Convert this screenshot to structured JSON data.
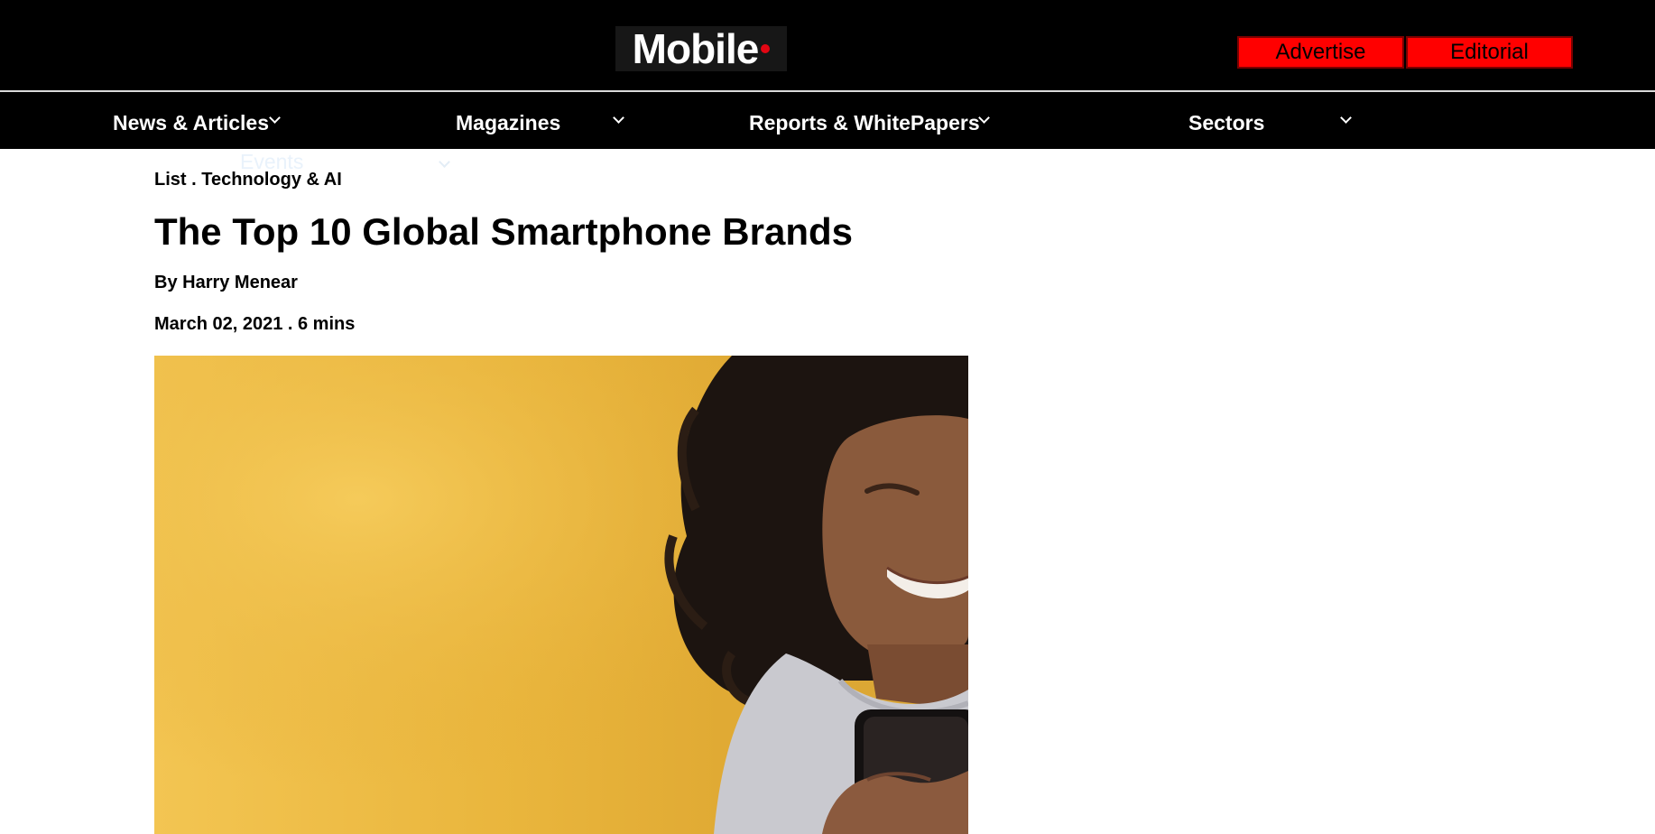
{
  "header": {
    "logo_text": "Mobile",
    "buttons": {
      "advertise": "Advertise",
      "editorial": "Editorial"
    }
  },
  "nav": {
    "items": [
      "News & Articles",
      "Magazines",
      "Reports & WhitePapers",
      "Sectors"
    ],
    "overflow_item": "Events"
  },
  "article": {
    "kicker": "List . Technology & AI",
    "title": "The Top 10 Global Smartphone Brands",
    "byline": "By Harry Menear",
    "date_line": "March 02, 2021 . 6 mins"
  },
  "colors": {
    "header_bg": "#000000",
    "button_red": "#ff0000",
    "logo_dot": "#e30613",
    "hero_yellow": "#f3c552"
  },
  "icons": [
    "chevron-down-icon"
  ]
}
